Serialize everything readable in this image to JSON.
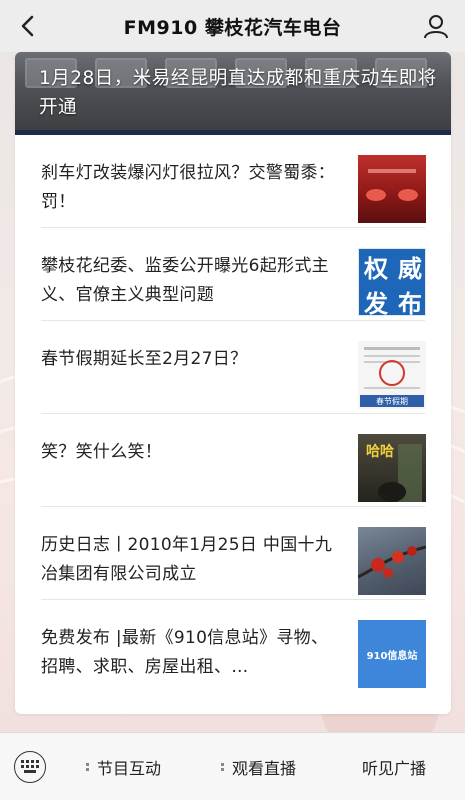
{
  "header": {
    "title": "FM910 攀枝花汽车电台",
    "back_icon": "chevron-left-icon",
    "profile_icon": "person-icon"
  },
  "hero": {
    "title": "1月28日，米易经昆明直达成都和重庆动车即将开通"
  },
  "articles": [
    {
      "title": "刹车灯改装爆闪灯很拉风？交警蜀黍：罚！"
    },
    {
      "title": "攀枝花纪委、监委公开曝光6起形式主义、官僚主义典型问题",
      "thumb_text": [
        "权",
        "威",
        "发",
        "布"
      ]
    },
    {
      "title": "春节假期延长至2月27日？",
      "thumb_caption": "春节假期"
    },
    {
      "title": "笑？笑什么笑！",
      "thumb_text": "哈哈"
    },
    {
      "title": "历史日志丨2010年1月25日 中国十九冶集团有限公司成立"
    },
    {
      "title": "免费发布 |最新《910信息站》寻物、招聘、求职、房屋出租、…",
      "thumb_text": "910信息站"
    }
  ],
  "bottom_menu": {
    "keyboard_icon": "keyboard-icon",
    "items": [
      {
        "label": "节目互动"
      },
      {
        "label": "观看直播"
      },
      {
        "label": "听见广播"
      }
    ]
  },
  "colors": {
    "header_bg": "#ededed",
    "card_bg": "#ffffff",
    "badge_blue": "#1e66b8"
  }
}
